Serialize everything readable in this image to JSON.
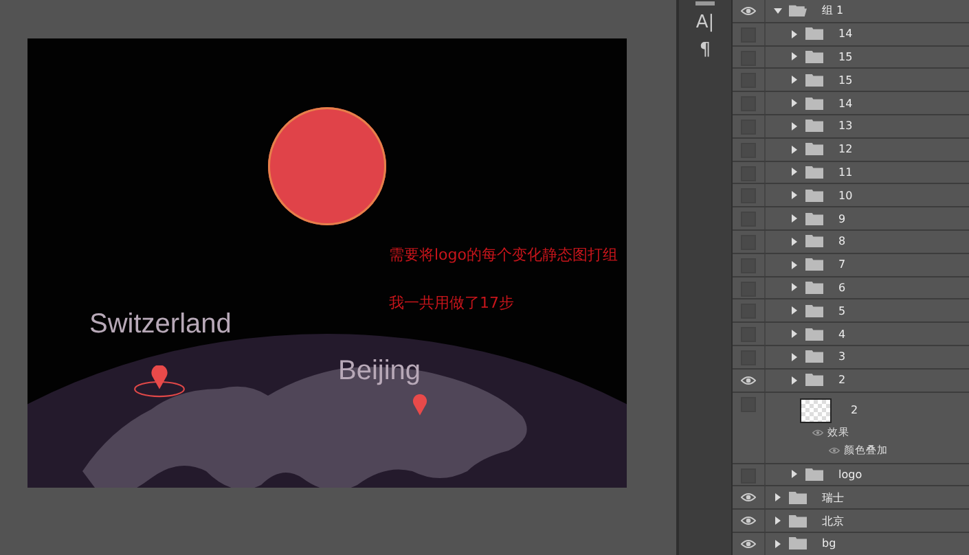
{
  "canvas": {
    "city_labels": [
      {
        "label": "Switzerland"
      },
      {
        "label": "Beijing"
      }
    ],
    "annotations": [
      "需要将logo的每个变化静态图打组",
      "我一共用做了17步"
    ]
  },
  "toolstrip": {
    "tools": [
      "A|",
      "¶"
    ]
  },
  "layers": [
    {
      "kind": "group",
      "name": "组 1",
      "visible": true,
      "expanded": true,
      "children": [
        {
          "kind": "group",
          "name": "14",
          "visible": false,
          "expanded": false
        },
        {
          "kind": "group",
          "name": "15",
          "visible": false,
          "expanded": false
        },
        {
          "kind": "group",
          "name": "15",
          "visible": false,
          "expanded": false
        },
        {
          "kind": "group",
          "name": "14",
          "visible": false,
          "expanded": false
        },
        {
          "kind": "group",
          "name": "13",
          "visible": false,
          "expanded": false
        },
        {
          "kind": "group",
          "name": "12",
          "visible": false,
          "expanded": false
        },
        {
          "kind": "group",
          "name": "11",
          "visible": false,
          "expanded": false
        },
        {
          "kind": "group",
          "name": "10",
          "visible": false,
          "expanded": false
        },
        {
          "kind": "group",
          "name": "9",
          "visible": false,
          "expanded": false
        },
        {
          "kind": "group",
          "name": "8",
          "visible": false,
          "expanded": false
        },
        {
          "kind": "group",
          "name": "7",
          "visible": false,
          "expanded": false
        },
        {
          "kind": "group",
          "name": "6",
          "visible": false,
          "expanded": false
        },
        {
          "kind": "group",
          "name": "5",
          "visible": false,
          "expanded": false
        },
        {
          "kind": "group",
          "name": "4",
          "visible": false,
          "expanded": false
        },
        {
          "kind": "group",
          "name": "3",
          "visible": false,
          "expanded": false
        },
        {
          "kind": "group",
          "name": "2",
          "visible": true,
          "expanded": false
        },
        {
          "kind": "layer",
          "name": "2",
          "visible": false,
          "effects": {
            "label": "效果",
            "children": [
              {
                "label": "颜色叠加"
              }
            ]
          }
        },
        {
          "kind": "group",
          "name": "logo",
          "visible": false,
          "expanded": false
        }
      ]
    },
    {
      "kind": "group",
      "name": "瑞士",
      "visible": true,
      "expanded": false
    },
    {
      "kind": "group",
      "name": "北京",
      "visible": true,
      "expanded": false
    },
    {
      "kind": "group",
      "name": "bg",
      "visible": true,
      "expanded": false
    }
  ]
}
